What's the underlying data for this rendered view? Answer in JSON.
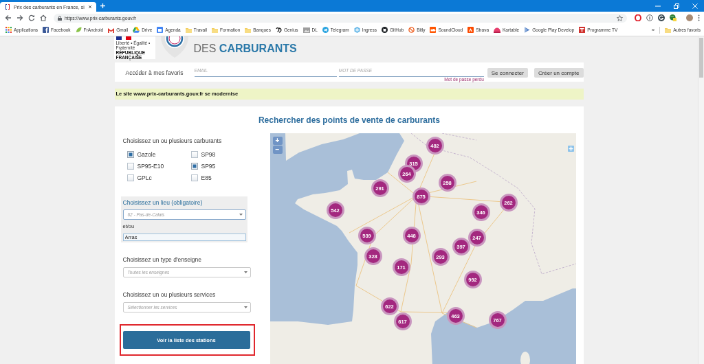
{
  "browser": {
    "tabs": [
      {
        "title": "Prix des carburants en France, si",
        "selected": true
      }
    ],
    "url": "https://www.prix-carburants.gouv.fr",
    "bookmarks": [
      {
        "label": "Applications",
        "kind": "site"
      },
      {
        "label": "Facebook",
        "kind": "site"
      },
      {
        "label": "FrAndroid",
        "kind": "site"
      },
      {
        "label": "Gmail",
        "kind": "site"
      },
      {
        "label": "Drive",
        "kind": "site"
      },
      {
        "label": "Agenda",
        "kind": "site"
      },
      {
        "label": "Travail",
        "kind": "folder"
      },
      {
        "label": "Formation",
        "kind": "folder"
      },
      {
        "label": "Banques",
        "kind": "folder"
      },
      {
        "label": "Genius",
        "kind": "site"
      },
      {
        "label": "DL",
        "kind": "site"
      },
      {
        "label": "Telegram",
        "kind": "site"
      },
      {
        "label": "Ingress",
        "kind": "site"
      },
      {
        "label": "GitHub",
        "kind": "site"
      },
      {
        "label": "Bitly",
        "kind": "site"
      },
      {
        "label": "SoundCloud",
        "kind": "site"
      },
      {
        "label": "Strava",
        "kind": "site"
      },
      {
        "label": "Kartable",
        "kind": "site"
      },
      {
        "label": "Google Play Develop",
        "kind": "site"
      },
      {
        "label": "Programme TV",
        "kind": "site"
      }
    ],
    "more_bookmarks": "»",
    "other_bookmarks": {
      "label": "Autres favoris",
      "kind": "folder"
    }
  },
  "header": {
    "logo_motto": "Liberté • Égalité • Fraternité",
    "logo_name": "RÉPUBLIQUE FRANÇAISE",
    "site_title": "DES **CARBURANTS**"
  },
  "login": {
    "label": "Accéder à mes favoris",
    "email": {
      "placeholder": "EMAIL"
    },
    "password": {
      "placeholder": "MOT DE PASSE"
    },
    "forgot_password": "Mot de passe perdu",
    "buttons": [
      "Se connecter",
      "Créer un compte"
    ]
  },
  "notice": "Le site www.prix-carburants.gouv.fr se modernise",
  "search": {
    "title": "Rechercher des points de vente de carburants",
    "fuels": {
      "label": "Choisissez un ou plusieurs carburants",
      "options": [
        {
          "label": "Gazole",
          "checked": true
        },
        {
          "label": "SP98",
          "checked": false
        },
        {
          "label": "SP95-E10",
          "checked": false
        },
        {
          "label": "SP95",
          "checked": true
        },
        {
          "label": "GPLc",
          "checked": false
        },
        {
          "label": "E85",
          "checked": false
        }
      ]
    },
    "location": {
      "label": "Choisissez un lieu (obligatoire)",
      "department": {
        "value": "62 - Pas-de-Calais"
      },
      "separator": "et/ou",
      "city": {
        "value": "Arras"
      }
    },
    "brand": {
      "label": "Choisissez un type d'enseigne",
      "placeholder": "Toutes les enseignes"
    },
    "services": {
      "label": "Choisissez un ou plusieurs services",
      "placeholder": "Sélectionner les services"
    },
    "submit": {
      "label": "Voir la liste des stations",
      "highlighted": true
    }
  },
  "map": {
    "zoom_in": "+",
    "zoom_out": "−",
    "clusters": [
      {
        "count": "482"
      },
      {
        "count": "315"
      },
      {
        "count": "264"
      },
      {
        "count": "258"
      },
      {
        "count": "291"
      },
      {
        "count": "875"
      },
      {
        "count": "262"
      },
      {
        "count": "542"
      },
      {
        "count": "346"
      },
      {
        "count": "539"
      },
      {
        "count": "448"
      },
      {
        "count": "247"
      },
      {
        "count": "397"
      },
      {
        "count": "328"
      },
      {
        "count": "293"
      },
      {
        "count": "171"
      },
      {
        "count": "992"
      },
      {
        "count": "622"
      },
      {
        "count": "463"
      },
      {
        "count": "767"
      },
      {
        "count": "617"
      }
    ]
  }
}
